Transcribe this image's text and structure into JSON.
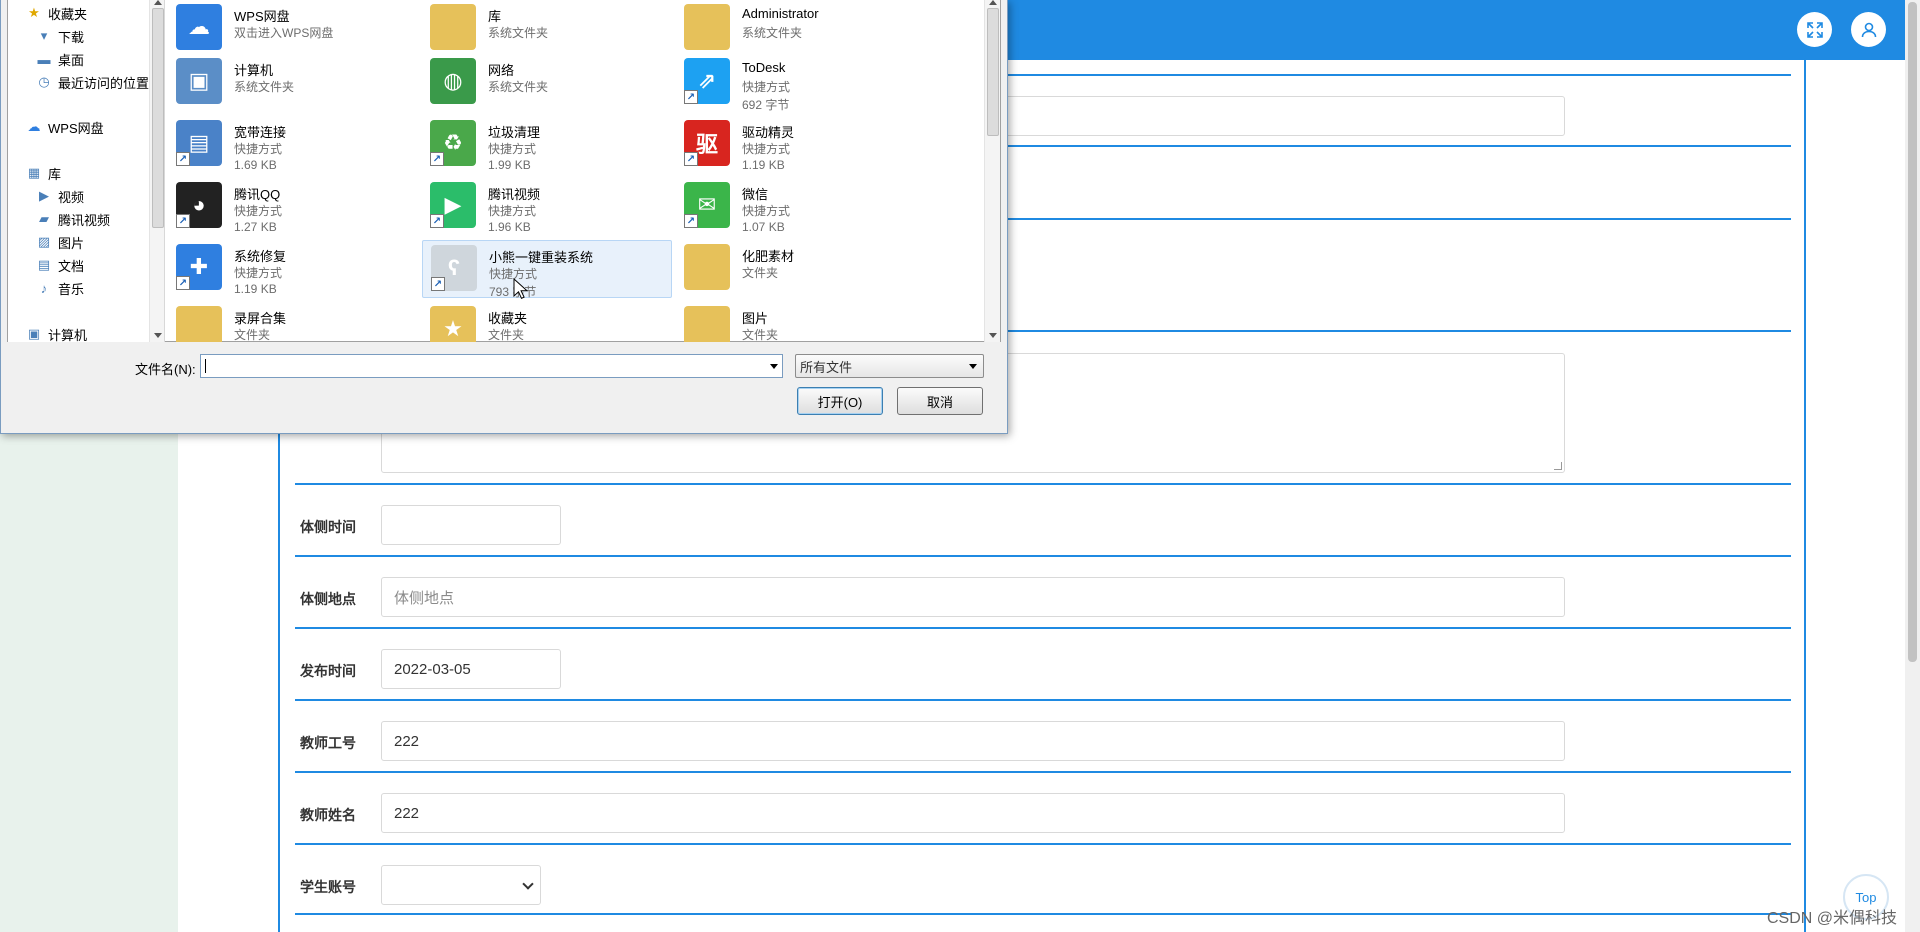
{
  "dialog": {
    "nav": [
      {
        "label": "收藏夹",
        "icon": "star-icon",
        "indent": 0
      },
      {
        "label": "下载",
        "icon": "download-folder-icon",
        "indent": 1
      },
      {
        "label": "桌面",
        "icon": "desktop-icon",
        "indent": 1
      },
      {
        "label": "最近访问的位置",
        "icon": "recent-places-icon",
        "indent": 1
      },
      {
        "label": "WPS网盘",
        "icon": "cloud-icon",
        "indent": 0
      },
      {
        "label": "库",
        "icon": "library-icon",
        "indent": 0
      },
      {
        "label": "视频",
        "icon": "video-icon",
        "indent": 1
      },
      {
        "label": "腾讯视频",
        "icon": "folder-icon",
        "indent": 1
      },
      {
        "label": "图片",
        "icon": "picture-icon",
        "indent": 1
      },
      {
        "label": "文档",
        "icon": "document-icon",
        "indent": 1
      },
      {
        "label": "音乐",
        "icon": "music-icon",
        "indent": 1
      },
      {
        "label": "计算机",
        "icon": "computer-icon",
        "indent": 0
      }
    ],
    "files": [
      {
        "name": "WPS网盘",
        "sub": "双击进入WPS网盘",
        "size": "",
        "icon": "wps-cloud-icon",
        "color": "#2f7fe0",
        "glyph": "☁",
        "shortcut": false
      },
      {
        "name": "库",
        "sub": "系统文件夹",
        "size": "",
        "icon": "library-folder-icon",
        "color": "#e6c15a",
        "glyph": "",
        "shortcut": false
      },
      {
        "name": "Administrator",
        "sub": "系统文件夹",
        "size": "",
        "icon": "user-folder-icon",
        "color": "#e6c15a",
        "glyph": "",
        "shortcut": false
      },
      {
        "name": "计算机",
        "sub": "系统文件夹",
        "size": "",
        "icon": "computer-icon",
        "color": "#5b8ec7",
        "glyph": "▣",
        "shortcut": false
      },
      {
        "name": "网络",
        "sub": "系统文件夹",
        "size": "",
        "icon": "network-globe-icon",
        "color": "#3a9a4a",
        "glyph": "◍",
        "shortcut": false
      },
      {
        "name": "ToDesk",
        "sub": "快捷方式",
        "size": "692 字节",
        "icon": "todesk-icon",
        "color": "#1da1f2",
        "glyph": "⇗",
        "shortcut": true
      },
      {
        "name": "宽带连接",
        "sub": "快捷方式",
        "size": "1.69 KB",
        "icon": "broadband-icon",
        "color": "#4a82c8",
        "glyph": "▤",
        "shortcut": true
      },
      {
        "name": "垃圾清理",
        "sub": "快捷方式",
        "size": "1.99 KB",
        "icon": "trash-cleanup-icon",
        "color": "#4aa84a",
        "glyph": "♻",
        "shortcut": true
      },
      {
        "name": "驱动精灵",
        "sub": "快捷方式",
        "size": "1.19 KB",
        "icon": "driver-genius-icon",
        "color": "#d8251f",
        "glyph": "驱",
        "shortcut": true
      },
      {
        "name": "腾讯QQ",
        "sub": "快捷方式",
        "size": "1.27 KB",
        "icon": "qq-penguin-icon",
        "color": "#222222",
        "glyph": "◕",
        "shortcut": true
      },
      {
        "name": "腾讯视频",
        "sub": "快捷方式",
        "size": "1.96 KB",
        "icon": "tencent-video-icon",
        "color": "#2bbd6a",
        "glyph": "▶",
        "shortcut": true
      },
      {
        "name": "微信",
        "sub": "快捷方式",
        "size": "1.07 KB",
        "icon": "wechat-icon",
        "color": "#3bb54a",
        "glyph": "✉",
        "shortcut": true
      },
      {
        "name": "系统修复",
        "sub": "快捷方式",
        "size": "1.19 KB",
        "icon": "system-repair-icon",
        "color": "#2f7fe0",
        "glyph": "✚",
        "shortcut": true
      },
      {
        "name": "小熊一键重装系统",
        "sub": "快捷方式",
        "size": "793 字节",
        "icon": "bear-reinstall-icon",
        "color": "#cfd6dc",
        "glyph": "ʕ",
        "shortcut": true
      },
      {
        "name": "化肥素材",
        "sub": "文件夹",
        "size": "",
        "icon": "folder-icon",
        "color": "#e6c15a",
        "glyph": "",
        "shortcut": false
      },
      {
        "name": "录屏合集",
        "sub": "文件夹",
        "size": "",
        "icon": "folder-icon",
        "color": "#e6c15a",
        "glyph": "",
        "shortcut": false
      },
      {
        "name": "收藏夹",
        "sub": "文件夹",
        "size": "",
        "icon": "favorites-folder-icon",
        "color": "#e6c15a",
        "glyph": "★",
        "shortcut": false
      },
      {
        "name": "图片",
        "sub": "文件夹",
        "size": "",
        "icon": "picture-folder-icon",
        "color": "#e6c15a",
        "glyph": "",
        "shortcut": false
      }
    ],
    "filename_label": "文件名(N):",
    "filename_value": "",
    "filetype": "所有文件",
    "open_label": "打开(O)",
    "cancel_label": "取消"
  },
  "form": {
    "fields": [
      {
        "label": "体侧时间",
        "value": "",
        "placeholder": "",
        "width": "short",
        "kind": "input"
      },
      {
        "label": "体侧地点",
        "value": "",
        "placeholder": "体侧地点",
        "width": "long",
        "kind": "input"
      },
      {
        "label": "发布时间",
        "value": "2022-03-05",
        "placeholder": "",
        "width": "short",
        "kind": "input"
      },
      {
        "label": "教师工号",
        "value": "222",
        "placeholder": "",
        "width": "long",
        "kind": "input"
      },
      {
        "label": "教师姓名",
        "value": "222",
        "placeholder": "",
        "width": "long",
        "kind": "input"
      },
      {
        "label": "学生账号",
        "value": "",
        "placeholder": "",
        "width": "select",
        "kind": "select"
      }
    ]
  },
  "top_button_label": "Top",
  "watermark": "CSDN @米偶科技",
  "colors": {
    "accent": "#1f8ae2",
    "rail": "#e8f2ec"
  }
}
